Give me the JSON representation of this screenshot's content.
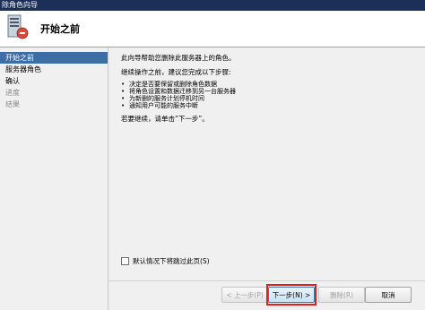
{
  "window": {
    "title": "除角色向导"
  },
  "header": {
    "title": "开始之前"
  },
  "nav": {
    "items": [
      {
        "label": "开始之前"
      },
      {
        "label": "服务器角色"
      },
      {
        "label": "确认"
      },
      {
        "label": "进度"
      },
      {
        "label": "结果"
      }
    ]
  },
  "content": {
    "intro": "此向导帮助您删除此服务器上的角色。",
    "before": "继续操作之前，建议您完成以下步骤:",
    "bullets": [
      "决定是否要保留或删除角色数据",
      "将角色设置和数据迁移到另一台服务器",
      "为新删的服务计划停机时间",
      "通知用户可能的服务中断"
    ],
    "continue": "若要继续，请单击“下一步”。"
  },
  "skip": {
    "label": "默认情况下将跳过此页(S)"
  },
  "buttons": {
    "prev": "< 上一步(P)",
    "next": "下一步(N) >",
    "remove": "删除(R)",
    "cancel": "取消"
  }
}
